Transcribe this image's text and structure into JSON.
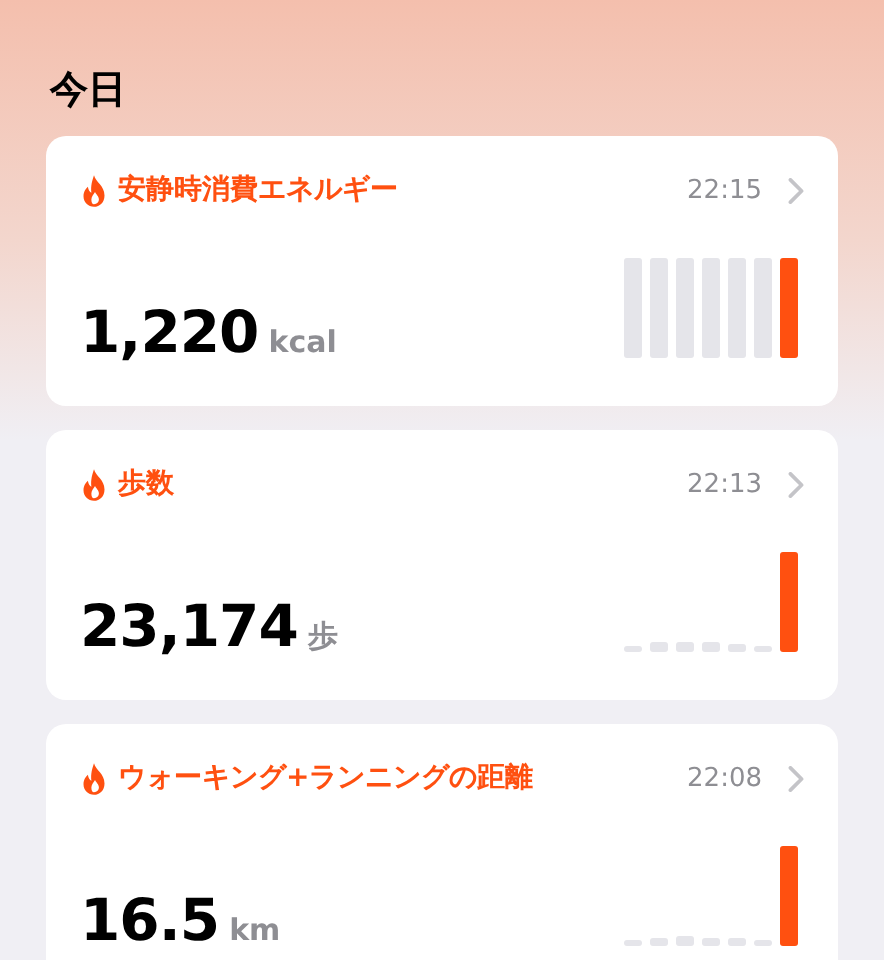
{
  "section_title": "今日",
  "cards": [
    {
      "title": "安静時消費エネルギー",
      "time": "22:15",
      "value": "1,220",
      "unit": "kcal"
    },
    {
      "title": "歩数",
      "time": "22:13",
      "value": "23,174",
      "unit": "歩"
    },
    {
      "title": "ウォーキング+ランニングの距離",
      "time": "22:08",
      "value": "16.5",
      "unit": "km"
    }
  ]
}
